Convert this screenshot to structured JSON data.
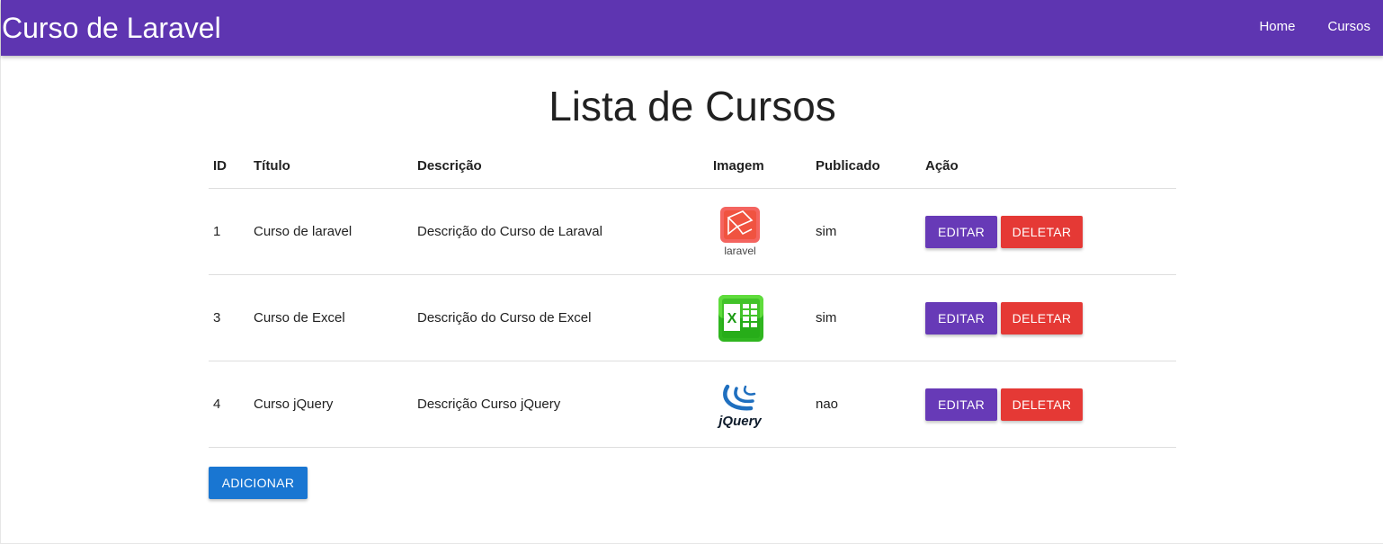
{
  "navbar": {
    "brand": "Curso de Laravel",
    "links": [
      "Home",
      "Cursos"
    ]
  },
  "page": {
    "title": "Lista de Cursos"
  },
  "table": {
    "headers": [
      "ID",
      "Título",
      "Descrição",
      "Imagem",
      "Publicado",
      "Ação"
    ],
    "rows": [
      {
        "id": "1",
        "title": "Curso de laravel",
        "description": "Descrição do Curso de Laraval",
        "image": "laravel-logo",
        "image_text": "laravel",
        "published": "sim"
      },
      {
        "id": "3",
        "title": "Curso de Excel",
        "description": "Descrição do Curso de Excel",
        "image": "excel-logo",
        "image_text": "X",
        "published": "sim"
      },
      {
        "id": "4",
        "title": "Curso jQuery",
        "description": "Descrição Curso jQuery",
        "image": "jquery-logo",
        "image_text": "jQuery",
        "published": "nao"
      }
    ]
  },
  "actions": {
    "edit_label": "EDITAR",
    "delete_label": "DELETAR",
    "add_label": "ADICIONAR"
  },
  "colors": {
    "navbar": "#5e35b1",
    "edit_button": "#673ab7",
    "delete_button": "#e53935",
    "add_button": "#1976d2"
  }
}
